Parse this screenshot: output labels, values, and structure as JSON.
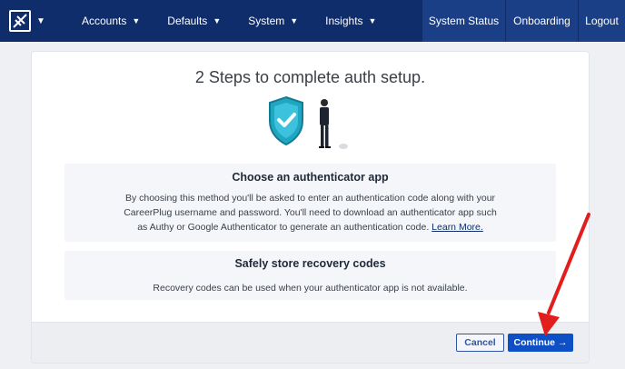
{
  "nav": {
    "items": [
      {
        "label": "Accounts"
      },
      {
        "label": "Defaults"
      },
      {
        "label": "System"
      },
      {
        "label": "Insights"
      }
    ],
    "right": [
      {
        "label": "System Status"
      },
      {
        "label": "Onboarding"
      },
      {
        "label": "Logout"
      }
    ]
  },
  "page": {
    "title": "2 Steps to complete auth setup."
  },
  "step1": {
    "heading": "Choose an authenticator app",
    "line1": "By choosing this method you'll be asked to enter an authentication code along with your",
    "line2": "CareerPlug username and password. You'll need to download an authenticator app such",
    "line3": "as Authy or Google Authenticator to generate an authentication code.",
    "link": "Learn More."
  },
  "step2": {
    "heading": "Safely store recovery codes",
    "text": "Recovery codes can be used when your authenticator app is not available."
  },
  "footer": {
    "cancel_label": "Cancel",
    "continue_label": "Continue",
    "continue_arrow": "→"
  },
  "colors": {
    "nav_bg": "#0f2d6b",
    "primary": "#0e4fc6",
    "shield": "#1fa7c2",
    "annotation_arrow": "#e11d1d"
  }
}
